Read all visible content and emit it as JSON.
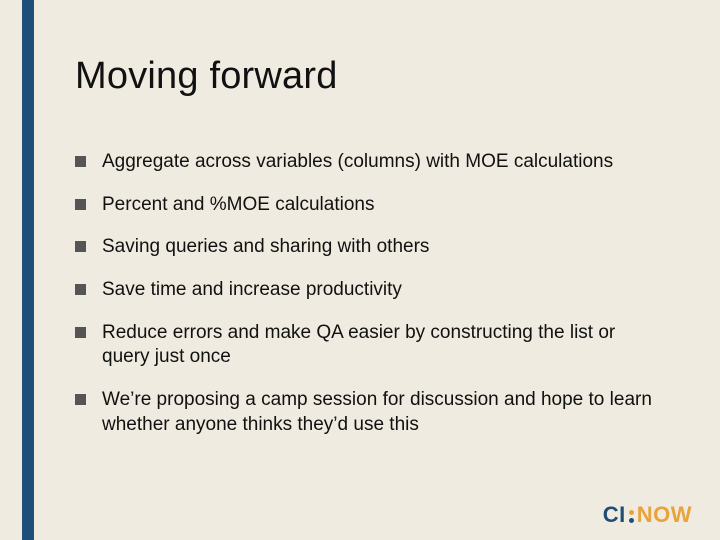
{
  "slide": {
    "title": "Moving forward",
    "bullets": [
      "Aggregate across variables (columns) with MOE calculations",
      "Percent and %MOE calculations",
      "Saving queries and sharing with others",
      "Save time and increase productivity",
      "Reduce errors and make QA easier by constructing the list or query just once",
      "We’re proposing a camp session for discussion and hope to learn whether anyone thinks they’d use this"
    ]
  },
  "logo": {
    "left": "CI",
    "right": "NOW"
  },
  "colors": {
    "background": "#f0ebe0",
    "accent": "#1f4e79",
    "logoOrange": "#e8a33d"
  }
}
